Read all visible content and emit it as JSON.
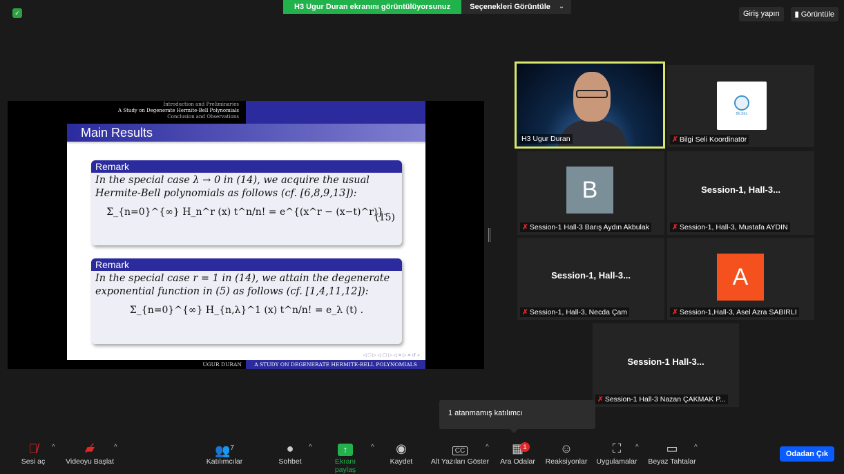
{
  "top": {
    "share_banner": "H3 Ugur Duran ekranını görüntülüyorsunuz",
    "view_options": "Seçenekleri Görüntüle",
    "sign_in": "Giriş yapın",
    "view": "Görüntüle"
  },
  "slide": {
    "header_line1": "Introduction and Preliminaries",
    "header_line2": "A Study on Degenerate Hermite-Bell Polynomials",
    "header_line3": "Conclusion and Observations",
    "title": "Main Results",
    "remark1_title": "Remark",
    "remark1_text": "In the special case λ → 0 in (14), we acquire the usual Hermite-Bell polynomials as follows (cf. [6,8,9,13]):",
    "remark1_formula": "Σ_{n=0}^{∞} H_n^r (x) t^n/n! = e^{(x^r − (x−t)^r)}.",
    "remark1_eqno": "(15)",
    "remark2_title": "Remark",
    "remark2_text": "In the special case r = 1 in (14), we attain the degenerate exponential function in (5) as follows (cf. [1,4,11,12]):",
    "remark2_formula": "Σ_{n=0}^{∞} H_{n,λ}^1 (x) t^n/n! = e_λ (t) .",
    "footer_author": "UGUR DURAN",
    "footer_title": "A STUDY ON DEGENERATE HERMITE-BELL POLYNOMIALS"
  },
  "participants": [
    {
      "name": "H3 Ugur Duran"
    },
    {
      "name": "Bilgi Seli Koordinatör",
      "logo_text": "BİLSEL"
    },
    {
      "name": "Session-1 Hall-3 Barış Aydın Akbulak",
      "initial": "B"
    },
    {
      "name": "Session-1, Hall-3, Mustafa AYDIN",
      "display": "Session-1,  Hall-3..."
    },
    {
      "name": "Session-1, Hall-3, Necda Çam",
      "display": "Session-1,  Hall-3..."
    },
    {
      "name": "Session-1,Hall-3, Asel Azra SABIRLI",
      "initial": "A"
    },
    {
      "name": "Session-1 Hall-3 Nazan ÇAKMAK P...",
      "display": "Session-1  Hall-3..."
    }
  ],
  "tooltip": "1 atanmamış katılımcı",
  "toolbar": {
    "mute": "Sesi aç",
    "video": "Videoyu Başlat",
    "participants": "Katılımcılar",
    "participant_count": "7",
    "chat": "Sohbet",
    "share": "Ekranı paylaş",
    "record": "Kaydet",
    "captions": "Alt Yazıları Göster",
    "breakout": "Ara Odalar",
    "breakout_badge": "1",
    "reactions": "Reaksiyonlar",
    "apps": "Uygulamalar",
    "whiteboard": "Beyaz Tahtalar",
    "leave": "Odadan Çık"
  },
  "colors": {
    "share_green": "#22b24c",
    "leave_blue": "#0b5cff",
    "active_speaker": "#d9e86a",
    "beamer_blue": "#2b2b9e"
  }
}
